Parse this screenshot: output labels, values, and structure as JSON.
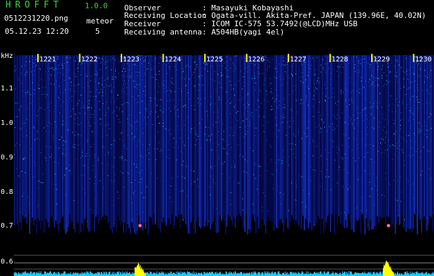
{
  "app": {
    "name": "HROFFT",
    "version": "1.0.0"
  },
  "file": {
    "name": "0512231220.png",
    "datetime": "05.12.23 12:20"
  },
  "meteor": {
    "label": "meteor",
    "count": "5"
  },
  "station": {
    "observer_label": "Observer",
    "observer_value": ": Masayuki Kobayashi",
    "location_label": "Receiving Location",
    "location_value": ": Ogata-vill. Akita-Pref. JAPAN (139.96E, 40.02N)",
    "receiver_label": "Receiver",
    "receiver_value": ": ICOM IC-575 53.7492(@LCD)MHz USB",
    "antenna_label": "Receiving antenna",
    "antenna_value": ": A504HB(yagi 4el)"
  },
  "axis": {
    "unit": "kHz",
    "y_ticks": [
      "1.1",
      "1.0",
      "0.9",
      "0.8",
      "0.7",
      "0.6"
    ],
    "x_ticks": [
      "1221",
      "1222",
      "1223",
      "1224",
      "1225",
      "1226",
      "1227",
      "1228",
      "1229",
      "1230"
    ]
  },
  "colors": {
    "accent_green": "#3fcf3f",
    "noise_blue": "#1030c0",
    "echo_yellow": "#ffff00",
    "tick_yellow": "#ffff00"
  },
  "meteor_echo_minutes": [
    1223,
    1229
  ]
}
